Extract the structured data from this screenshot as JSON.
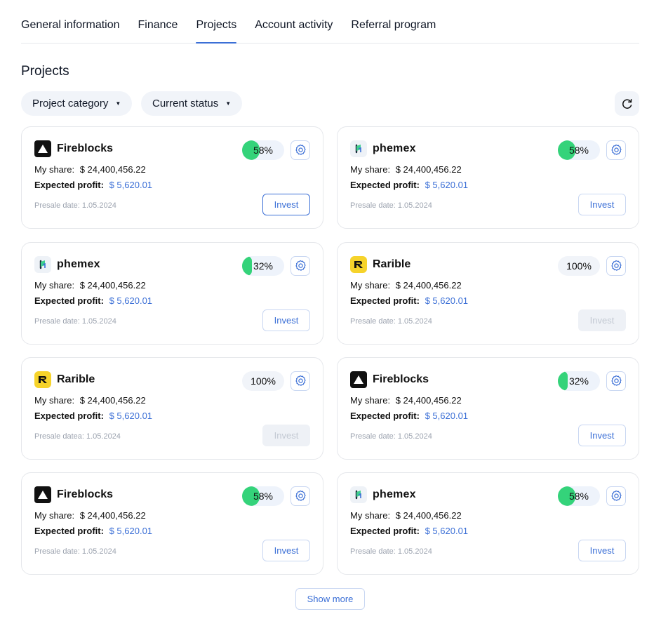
{
  "tabs": [
    {
      "label": "General information",
      "active": false
    },
    {
      "label": "Finance",
      "active": false
    },
    {
      "label": "Projects",
      "active": true
    },
    {
      "label": "Account activity",
      "active": false
    },
    {
      "label": "Referral program",
      "active": false
    }
  ],
  "page_title": "Projects",
  "filters": {
    "category_label": "Project category",
    "status_label": "Current status",
    "refresh_icon": "refresh-icon"
  },
  "colors": {
    "accent": "#3b6fd6",
    "progress_fill": "#34d37a",
    "pill_bg": "#f1f4f9"
  },
  "cards": [
    {
      "brand": "Fireblocks",
      "progress_text": "58%",
      "progress_value": 0.58,
      "share_label": "My share:",
      "share_value": "$ 24,400,456.22",
      "profit_label": "Expected profit:",
      "profit_value": "$ 5,620.01",
      "presale": "Presale date: 1.05.2024",
      "invest_label": "Invest",
      "invest_state": "focused"
    },
    {
      "brand": "phemex",
      "progress_text": "58%",
      "progress_value": 0.58,
      "share_label": "My share:",
      "share_value": "$ 24,400,456.22",
      "profit_label": "Expected profit:",
      "profit_value": "$ 5,620.01",
      "presale": "Presale date: 1.05.2024",
      "invest_label": "Invest",
      "invest_state": "normal"
    },
    {
      "brand": "phemex",
      "progress_text": "32%",
      "progress_value": 0.32,
      "share_label": "My share:",
      "share_value": "$ 24,400,456.22",
      "profit_label": "Expected profit:",
      "profit_value": "$ 5,620.01",
      "presale": "Presale date: 1.05.2024",
      "invest_label": "Invest",
      "invest_state": "normal"
    },
    {
      "brand": "Rarible",
      "progress_text": "100%",
      "progress_value": 1.0,
      "share_label": "My share:",
      "share_value": "$ 24,400,456.22",
      "profit_label": "Expected profit:",
      "profit_value": "$ 5,620.01",
      "presale": "Presale date: 1.05.2024",
      "invest_label": "Invest",
      "invest_state": "disabled"
    },
    {
      "brand": "Rarible",
      "progress_text": "100%",
      "progress_value": 1.0,
      "share_label": "My share:",
      "share_value": "$ 24,400,456.22",
      "profit_label": "Expected profit:",
      "profit_value": "$ 5,620.01",
      "presale": "Presale datea: 1.05.2024",
      "invest_label": "Invest",
      "invest_state": "disabled"
    },
    {
      "brand": "Fireblocks",
      "progress_text": "32%",
      "progress_value": 0.32,
      "share_label": "My share:",
      "share_value": "$ 24,400,456.22",
      "profit_label": "Expected profit:",
      "profit_value": "$ 5,620.01",
      "presale": "Presale date: 1.05.2024",
      "invest_label": "Invest",
      "invest_state": "normal"
    },
    {
      "brand": "Fireblocks",
      "progress_text": "58%",
      "progress_value": 0.58,
      "share_label": "My share:",
      "share_value": "$ 24,400,456.22",
      "profit_label": "Expected profit:",
      "profit_value": "$ 5,620.01",
      "presale": "Presale date: 1.05.2024",
      "invest_label": "Invest",
      "invest_state": "normal"
    },
    {
      "brand": "phemex",
      "progress_text": "58%",
      "progress_value": 0.58,
      "share_label": "My share:",
      "share_value": "$ 24,400,456.22",
      "profit_label": "Expected profit:",
      "profit_value": "$ 5,620.01",
      "presale": "Presale date: 1.05.2024",
      "invest_label": "Invest",
      "invest_state": "normal"
    }
  ],
  "show_more_label": "Show more"
}
